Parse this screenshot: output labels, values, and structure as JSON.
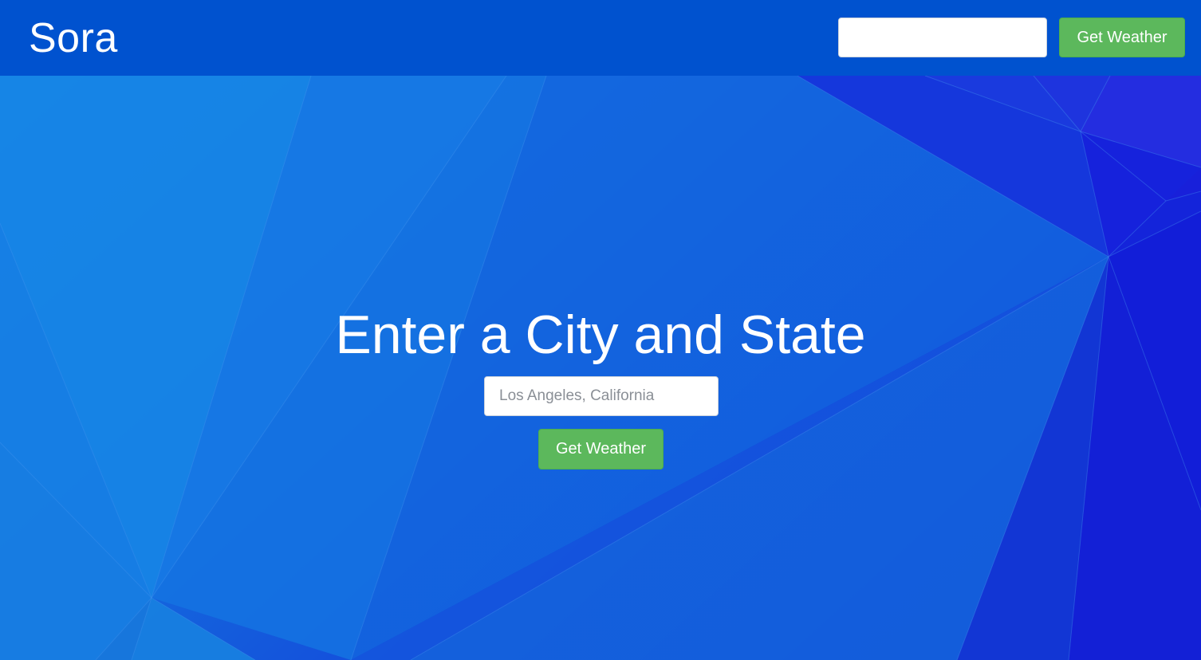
{
  "navbar": {
    "brand": "Sora",
    "search_value": "",
    "button_label": "Get Weather"
  },
  "hero": {
    "title": "Enter a City and State",
    "input_placeholder": "Los Angeles, California",
    "input_value": "",
    "button_label": "Get Weather"
  },
  "colors": {
    "navbar_bg": "#0052cf",
    "button_bg": "#5cb85c",
    "text": "#ffffff",
    "bg_left": "#1784e4",
    "bg_right": "#1320d8"
  }
}
